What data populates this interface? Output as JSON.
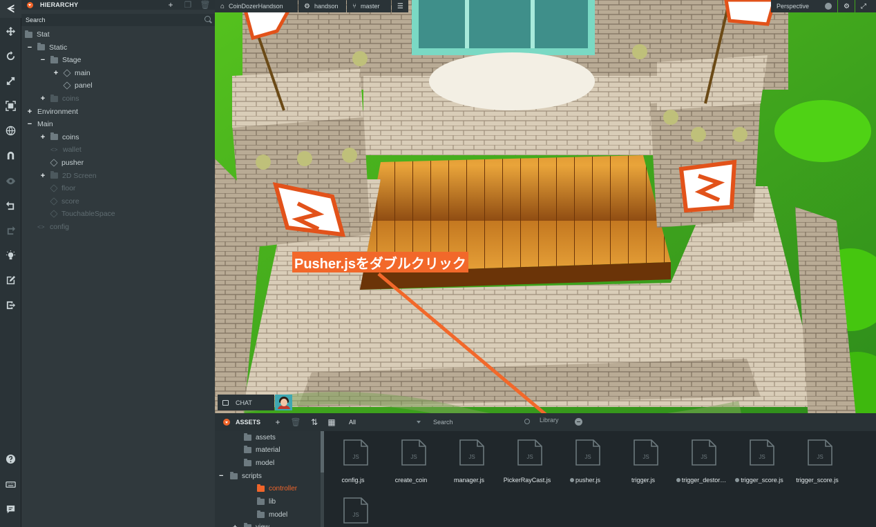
{
  "toolbar": {
    "logo": "ᗕ",
    "tools": [
      {
        "name": "move-icon",
        "dim": false
      },
      {
        "name": "rotate-icon",
        "dim": false
      },
      {
        "name": "scale-icon",
        "dim": false
      },
      {
        "name": "resize-icon",
        "dim": false
      },
      {
        "name": "world-icon",
        "dim": false
      },
      {
        "name": "magnet-icon",
        "dim": false
      },
      {
        "name": "eye-icon",
        "dim": true
      },
      {
        "name": "undo-icon",
        "dim": false
      },
      {
        "name": "redo-icon",
        "dim": true
      },
      {
        "name": "lightbulb-icon",
        "dim": false
      },
      {
        "name": "edit-icon",
        "dim": false
      },
      {
        "name": "launch-icon",
        "dim": false
      },
      {
        "name": "help-icon",
        "dim": false
      },
      {
        "name": "keyboard-icon",
        "dim": false
      },
      {
        "name": "chat-icon",
        "dim": false
      }
    ]
  },
  "hierarchy": {
    "title": "HIERARCHY",
    "search_placeholder": "Search",
    "items": [
      {
        "label": "Stat",
        "depth": 0,
        "toggle": "",
        "icon": "folder",
        "dim": false
      },
      {
        "label": "Static",
        "depth": 1,
        "toggle": "−",
        "icon": "folder",
        "dim": false
      },
      {
        "label": "Stage",
        "depth": 2,
        "toggle": "−",
        "icon": "folder",
        "dim": false
      },
      {
        "label": "main",
        "depth": 3,
        "toggle": "+",
        "icon": "cube",
        "dim": false
      },
      {
        "label": "panel",
        "depth": 3,
        "toggle": "",
        "icon": "cube",
        "dim": false
      },
      {
        "label": "coins",
        "depth": 2,
        "toggle": "+",
        "icon": "folder",
        "dim": true
      },
      {
        "label": "Environment",
        "depth": 1,
        "toggle": "+",
        "icon": "",
        "dim": false
      },
      {
        "label": "Main",
        "depth": 1,
        "toggle": "−",
        "icon": "",
        "dim": false
      },
      {
        "label": "coins",
        "depth": 2,
        "toggle": "+",
        "icon": "folder",
        "dim": false
      },
      {
        "label": "wallet",
        "depth": 2,
        "toggle": "",
        "icon": "code",
        "dim": true
      },
      {
        "label": "pusher",
        "depth": 2,
        "toggle": "",
        "icon": "cube",
        "dim": false
      },
      {
        "label": "2D Screen",
        "depth": 2,
        "toggle": "+",
        "icon": "folder",
        "dim": true
      },
      {
        "label": "floor",
        "depth": 2,
        "toggle": "",
        "icon": "cube",
        "dim": true
      },
      {
        "label": "score",
        "depth": 2,
        "toggle": "",
        "icon": "cube",
        "dim": true
      },
      {
        "label": "TouchableSpace",
        "depth": 2,
        "toggle": "",
        "icon": "cube",
        "dim": true
      },
      {
        "label": "config",
        "depth": 1,
        "toggle": "",
        "icon": "code",
        "dim": true
      }
    ]
  },
  "viewport": {
    "project": "CoinDozerHandson",
    "scene": "handson",
    "branch": "master",
    "camera": "Perspective"
  },
  "annotation": {
    "text": "Pusher.jsをダブルクリック",
    "color": "#f2682a"
  },
  "chat": {
    "label": "CHAT"
  },
  "assets": {
    "title": "ASSETS",
    "filter": "All",
    "search_placeholder": "Search",
    "library": "Library",
    "folders": [
      {
        "label": "assets",
        "depth": 1,
        "toggle": "",
        "active": false
      },
      {
        "label": "material",
        "depth": 1,
        "toggle": "",
        "active": false
      },
      {
        "label": "model",
        "depth": 1,
        "toggle": "",
        "active": false
      },
      {
        "label": "scripts",
        "depth": 0,
        "toggle": "−",
        "active": false
      },
      {
        "label": "controller",
        "depth": 2,
        "toggle": "",
        "active": true
      },
      {
        "label": "lib",
        "depth": 2,
        "toggle": "",
        "active": false
      },
      {
        "label": "model",
        "depth": 2,
        "toggle": "",
        "active": false
      },
      {
        "label": "view",
        "depth": 1,
        "toggle": "+",
        "active": false
      }
    ],
    "files": [
      {
        "name": "config.js",
        "bullet": false
      },
      {
        "name": "create_coin",
        "bullet": false
      },
      {
        "name": "manager.js",
        "bullet": false
      },
      {
        "name": "PickerRayCast.js",
        "bullet": false
      },
      {
        "name": "pusher.js",
        "bullet": true
      },
      {
        "name": "trigger.js",
        "bullet": false
      },
      {
        "name": "trigger_destor…",
        "bullet": true
      },
      {
        "name": "trigger_score.js",
        "bullet": true
      },
      {
        "name": "trigger_score.js",
        "bullet": false
      },
      {
        "name": "",
        "bullet": false
      }
    ],
    "file_type_label": "JS"
  }
}
